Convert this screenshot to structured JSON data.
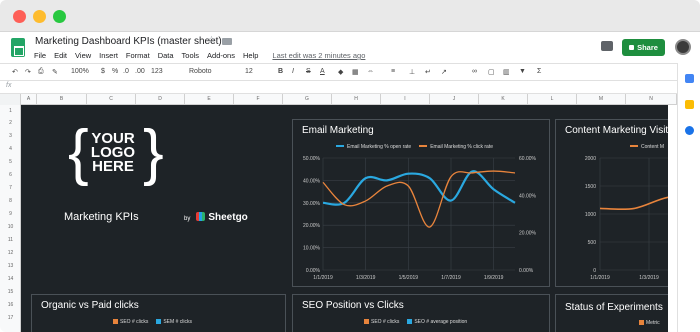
{
  "window": {
    "title": "Marketing Dashboard KPIs (master sheet)"
  },
  "menus": [
    "File",
    "Edit",
    "View",
    "Insert",
    "Format",
    "Data",
    "Tools",
    "Add-ons",
    "Help"
  ],
  "last_edit": "Last edit was 2 minutes ago",
  "share_label": "Share",
  "toolbar": {
    "zoom": "100%",
    "currency": "$",
    "percent": "%",
    "decimals1": ".0",
    "decimals2": ".00",
    "format": "123",
    "font": "Roboto",
    "size": "12",
    "bold": "B",
    "italic": "I",
    "strike": "S",
    "text_color": "A"
  },
  "formula_bar": {
    "fx": "fx"
  },
  "columns": [
    "A",
    "B",
    "C",
    "D",
    "E",
    "F",
    "G",
    "H",
    "I",
    "J",
    "K",
    "L",
    "M",
    "N"
  ],
  "rows": [
    "1",
    "2",
    "3",
    "4",
    "5",
    "6",
    "7",
    "8",
    "9",
    "10",
    "11",
    "12",
    "13",
    "14",
    "15",
    "16",
    "17"
  ],
  "dashboard": {
    "logo": [
      "YOUR",
      "LOGO",
      "HERE"
    ],
    "title": "Marketing KPIs",
    "by": "by",
    "brand": "Sheetgo"
  },
  "colors": {
    "blue": "#2aa8e0",
    "orange": "#e8843c",
    "dark": "#1e2327"
  },
  "panels": {
    "email": {
      "title": "Email Marketing",
      "legend": [
        "Email Marketing % open rate",
        "Email Marketing % click rate"
      ]
    },
    "content": {
      "title": "Content Marketing Visito",
      "legend": [
        "Content M"
      ]
    },
    "organic": {
      "title": "Organic vs Paid clicks",
      "legend": [
        "SEO # clicks",
        "SEM # clicks"
      ]
    },
    "seo": {
      "title": "SEO Position vs Clicks",
      "legend": [
        "SEO # clicks",
        "SEO # average position"
      ]
    },
    "experiments": {
      "title": "Status of Experiments",
      "legend": [
        "Metric"
      ]
    }
  },
  "chart_data": [
    {
      "type": "line",
      "title": "Email Marketing",
      "x": [
        "1/1/2019",
        "1/2/2019",
        "1/3/2019",
        "1/4/2019",
        "1/5/2019",
        "1/6/2019",
        "1/7/2019",
        "1/8/2019",
        "1/9/2019",
        "1/10/2019"
      ],
      "x_ticks": [
        "1/1/2019",
        "1/3/2019",
        "1/5/2019",
        "1/7/2019",
        "1/9/2019"
      ],
      "y_left_ticks": [
        "0.00%",
        "10.00%",
        "20.00%",
        "30.00%",
        "40.00%",
        "50.00%"
      ],
      "y_right_ticks": [
        "0.00%",
        "20.00%",
        "40.00%",
        "60.00%"
      ],
      "ylim_left": [
        0,
        50
      ],
      "ylim_right": [
        0,
        60
      ],
      "series": [
        {
          "name": "Email Marketing % open rate",
          "axis": "left",
          "color": "#2aa8e0",
          "values": [
            30,
            30,
            41,
            40,
            43,
            41,
            31,
            44,
            36,
            30
          ]
        },
        {
          "name": "Email Marketing % click rate",
          "axis": "right",
          "color": "#e8843c",
          "values": [
            47,
            35,
            37,
            45,
            45,
            23,
            50,
            52,
            53,
            52
          ]
        }
      ]
    },
    {
      "type": "line",
      "title": "Content Marketing Visito",
      "x_ticks": [
        "1/1/2019",
        "1/3/2019"
      ],
      "y_ticks": [
        "0",
        "500",
        "1000",
        "1500",
        "2000"
      ],
      "ylim": [
        0,
        2000
      ],
      "series": [
        {
          "name": "Content M",
          "color": "#e8843c",
          "values": [
            1100,
            1100,
            1300,
            1300
          ]
        }
      ]
    }
  ]
}
